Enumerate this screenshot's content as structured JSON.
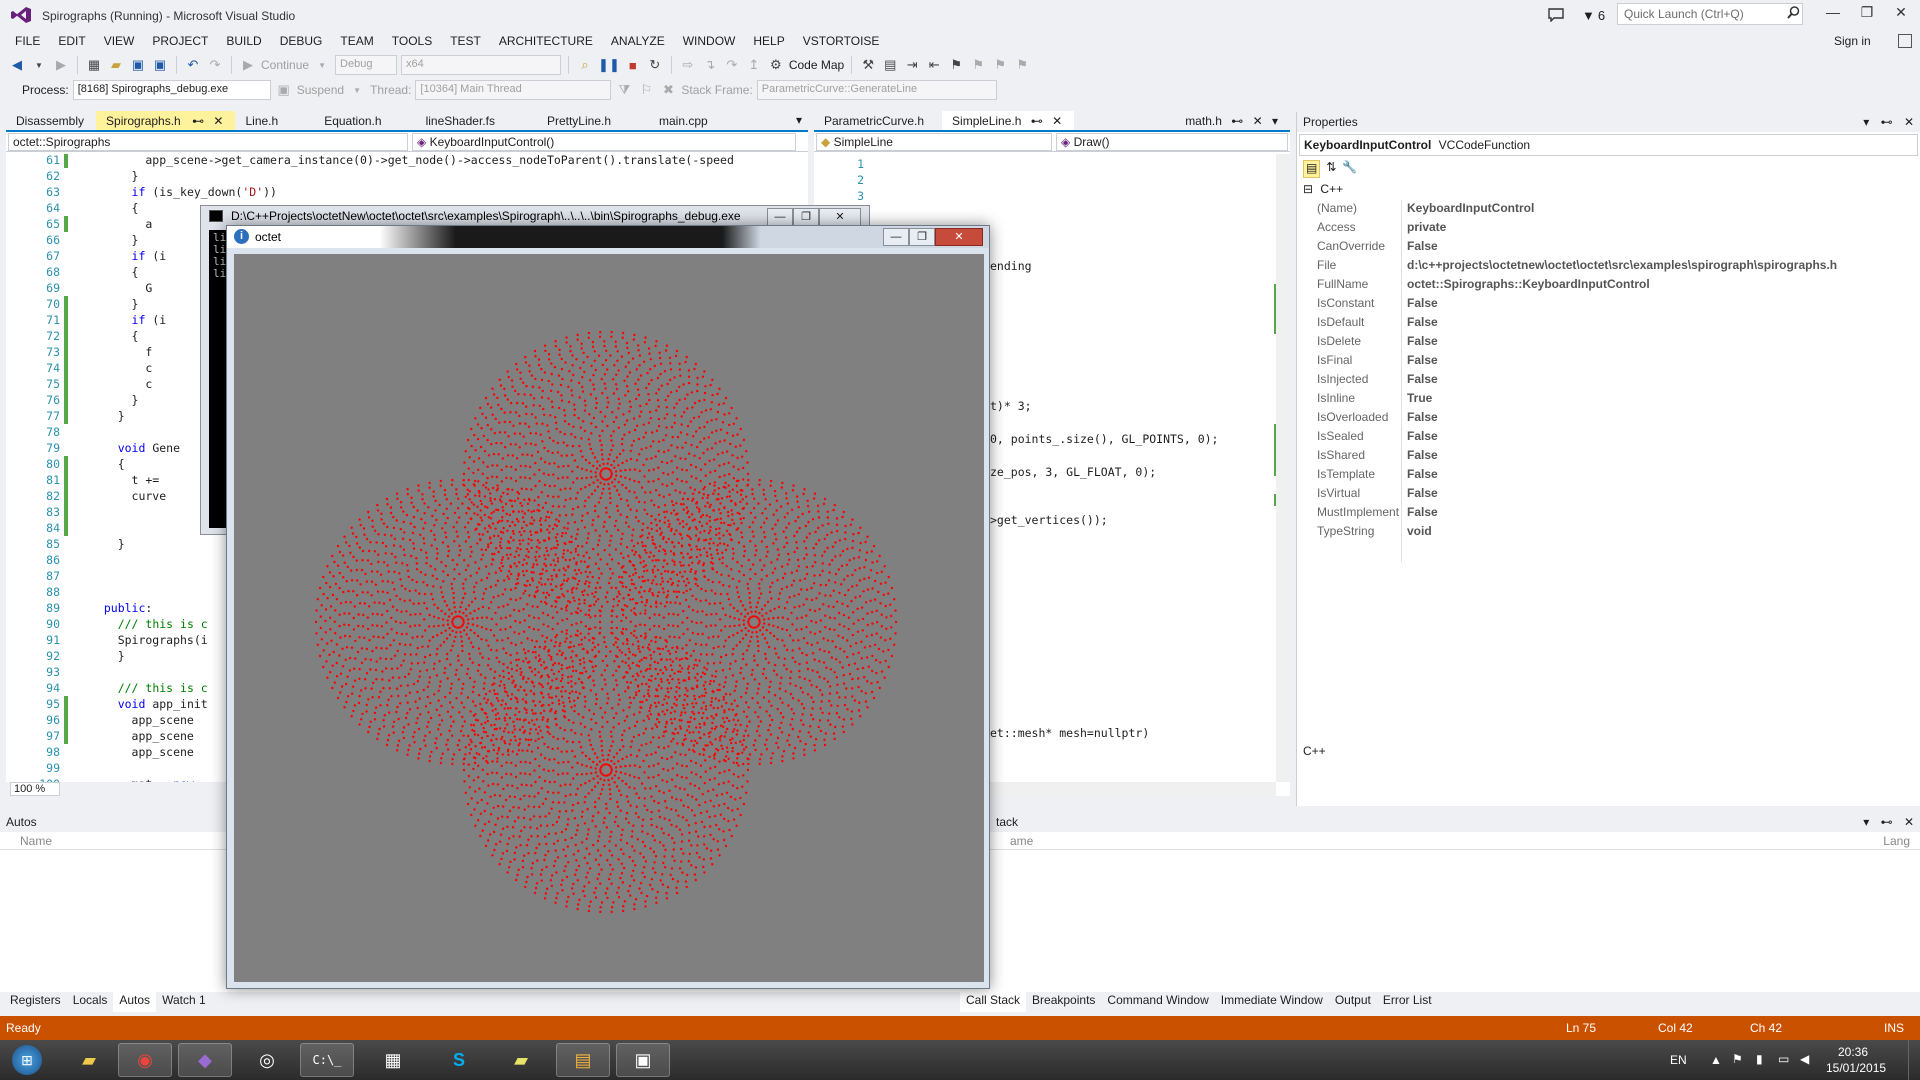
{
  "window": {
    "title": "Spirographs (Running) - Microsoft Visual Studio",
    "notification_count": "6",
    "quick_launch_placeholder": "Quick Launch (Ctrl+Q)",
    "sign_in": "Sign in"
  },
  "menu": [
    "FILE",
    "EDIT",
    "VIEW",
    "PROJECT",
    "BUILD",
    "DEBUG",
    "TEAM",
    "TOOLS",
    "TEST",
    "ARCHITECTURE",
    "ANALYZE",
    "WINDOW",
    "HELP",
    "VSTORTOISE"
  ],
  "toolbar": {
    "continue_label": "Continue",
    "config": "Debug",
    "platform": "x64",
    "code_map": "Code Map",
    "process_label": "Process:",
    "process_value": "[8168] Spirographs_debug.exe",
    "suspend_label": "Suspend",
    "thread_label": "Thread:",
    "thread_value": "[10364] Main Thread",
    "stack_frame_label": "Stack Frame:",
    "stack_frame_value": "ParametricCurve::GenerateLine"
  },
  "left_editor": {
    "tabs": [
      "Disassembly",
      "Spirographs.h",
      "Line.h",
      "Equation.h",
      "lineShader.fs",
      "PrettyLine.h",
      "main.cpp"
    ],
    "active_tab": "Spirographs.h",
    "nav_scope": "octet::Spirographs",
    "nav_member": "KeyboardInputControl()",
    "zoom": "100 %",
    "lines": [
      {
        "n": "61",
        "t": "        app_scene->get_camera_instance(0)->get_node()->access_nodeToParent().translate(-speed"
      },
      {
        "n": "62",
        "t": "      }"
      },
      {
        "n": "63",
        "t": "      if (is_key_down('D'))"
      },
      {
        "n": "64",
        "t": "      {"
      },
      {
        "n": "65",
        "t": "        a"
      },
      {
        "n": "66",
        "t": "      }"
      },
      {
        "n": "67",
        "t": "      if (i"
      },
      {
        "n": "68",
        "t": "      {"
      },
      {
        "n": "69",
        "t": "        G"
      },
      {
        "n": "70",
        "t": "      }"
      },
      {
        "n": "71",
        "t": "      if (i"
      },
      {
        "n": "72",
        "t": "      {"
      },
      {
        "n": "73",
        "t": "        f"
      },
      {
        "n": "74",
        "t": "        c"
      },
      {
        "n": "75",
        "t": "        c"
      },
      {
        "n": "76",
        "t": "      }"
      },
      {
        "n": "77",
        "t": "    }"
      },
      {
        "n": "78",
        "t": ""
      },
      {
        "n": "79",
        "t": "    void Gene"
      },
      {
        "n": "80",
        "t": "    {"
      },
      {
        "n": "81",
        "t": "      t +="
      },
      {
        "n": "82",
        "t": "      curve"
      },
      {
        "n": "83",
        "t": ""
      },
      {
        "n": "84",
        "t": ""
      },
      {
        "n": "85",
        "t": "    }"
      },
      {
        "n": "86",
        "t": ""
      },
      {
        "n": "87",
        "t": ""
      },
      {
        "n": "88",
        "t": ""
      },
      {
        "n": "89",
        "t": "  public:"
      },
      {
        "n": "90",
        "t": "    /// this is c"
      },
      {
        "n": "91",
        "t": "    Spirographs(i"
      },
      {
        "n": "92",
        "t": "    }"
      },
      {
        "n": "93",
        "t": ""
      },
      {
        "n": "94",
        "t": "    /// this is c"
      },
      {
        "n": "95",
        "t": "    void app_init"
      },
      {
        "n": "96",
        "t": "      app_scene"
      },
      {
        "n": "97",
        "t": "      app_scene"
      },
      {
        "n": "98",
        "t": "      app_scene"
      },
      {
        "n": "99",
        "t": ""
      },
      {
        "n": "100",
        "t": "      mat = new"
      }
    ]
  },
  "right_editor": {
    "tabs": [
      "ParametricCurve.h",
      "SimpleLine.h",
      "math.h"
    ],
    "active_tab": "SimpleLine.h",
    "nav_scope": "SimpleLine",
    "nav_member": "Draw()",
    "line_numbers": [
      "1",
      "2",
      "3"
    ],
    "fragments": [
      {
        "t": "ending"
      },
      {
        "t": "t)* 3;"
      },
      {
        "t": "0, points_.size(), GL_POINTS, 0);"
      },
      {
        "t": "ze_pos, 3, GL_FLOAT, 0);"
      },
      {
        "t": ">get_vertices());"
      },
      {
        "t": "et::mesh* mesh=nullptr)"
      }
    ]
  },
  "properties": {
    "title": "Properties",
    "object_name": "KeyboardInputControl",
    "object_type": "VCCodeFunction",
    "category": "C++",
    "rows": [
      {
        "name": "(Name)",
        "value": "KeyboardInputControl"
      },
      {
        "name": "Access",
        "value": "private"
      },
      {
        "name": "CanOverride",
        "value": "False"
      },
      {
        "name": "File",
        "value": "d:\\c++projects\\octetnew\\octet\\octet\\src\\examples\\spirograph\\spirographs.h"
      },
      {
        "name": "FullName",
        "value": "octet::Spirographs::KeyboardInputControl"
      },
      {
        "name": "IsConstant",
        "value": "False"
      },
      {
        "name": "IsDefault",
        "value": "False"
      },
      {
        "name": "IsDelete",
        "value": "False"
      },
      {
        "name": "IsFinal",
        "value": "False"
      },
      {
        "name": "IsInjected",
        "value": "False"
      },
      {
        "name": "IsInline",
        "value": "True"
      },
      {
        "name": "IsOverloaded",
        "value": "False"
      },
      {
        "name": "IsSealed",
        "value": "False"
      },
      {
        "name": "IsShared",
        "value": "False"
      },
      {
        "name": "IsTemplate",
        "value": "False"
      },
      {
        "name": "IsVirtual",
        "value": "False"
      },
      {
        "name": "MustImplement",
        "value": "False"
      },
      {
        "name": "TypeString",
        "value": "void"
      }
    ],
    "description": "C++"
  },
  "autos": {
    "title": "Autos",
    "col_name": "Name",
    "tabs": [
      "Registers",
      "Locals",
      "Autos",
      "Watch 1"
    ],
    "active_tab": "Autos"
  },
  "callstack": {
    "title": "tack",
    "col_name": "ame",
    "col_lang": "Lang",
    "tabs": [
      "Call Stack",
      "Breakpoints",
      "Command Window",
      "Immediate Window",
      "Output",
      "Error List"
    ],
    "active_tab": "Call Stack"
  },
  "statusbar": {
    "state": "Ready",
    "line": "Ln 75",
    "col": "Col 42",
    "ch": "Ch 42",
    "mode": "INS"
  },
  "console": {
    "title": "D:\\C++Projects\\octetNew\\octet\\octet\\src\\examples\\Spirograph\\..\\..\\..\\bin\\Spirographs_debug.exe",
    "text": "li\nli\nli\nli"
  },
  "octet": {
    "title": "octet",
    "point_color": "#ff0000",
    "background": "#808080"
  },
  "taskbar": {
    "language": "EN",
    "time": "20:36",
    "date": "15/01/2015"
  },
  "colors": {
    "accent": "#007acc",
    "status_bar": "#ca5100",
    "active_tab": "#fff29d"
  }
}
